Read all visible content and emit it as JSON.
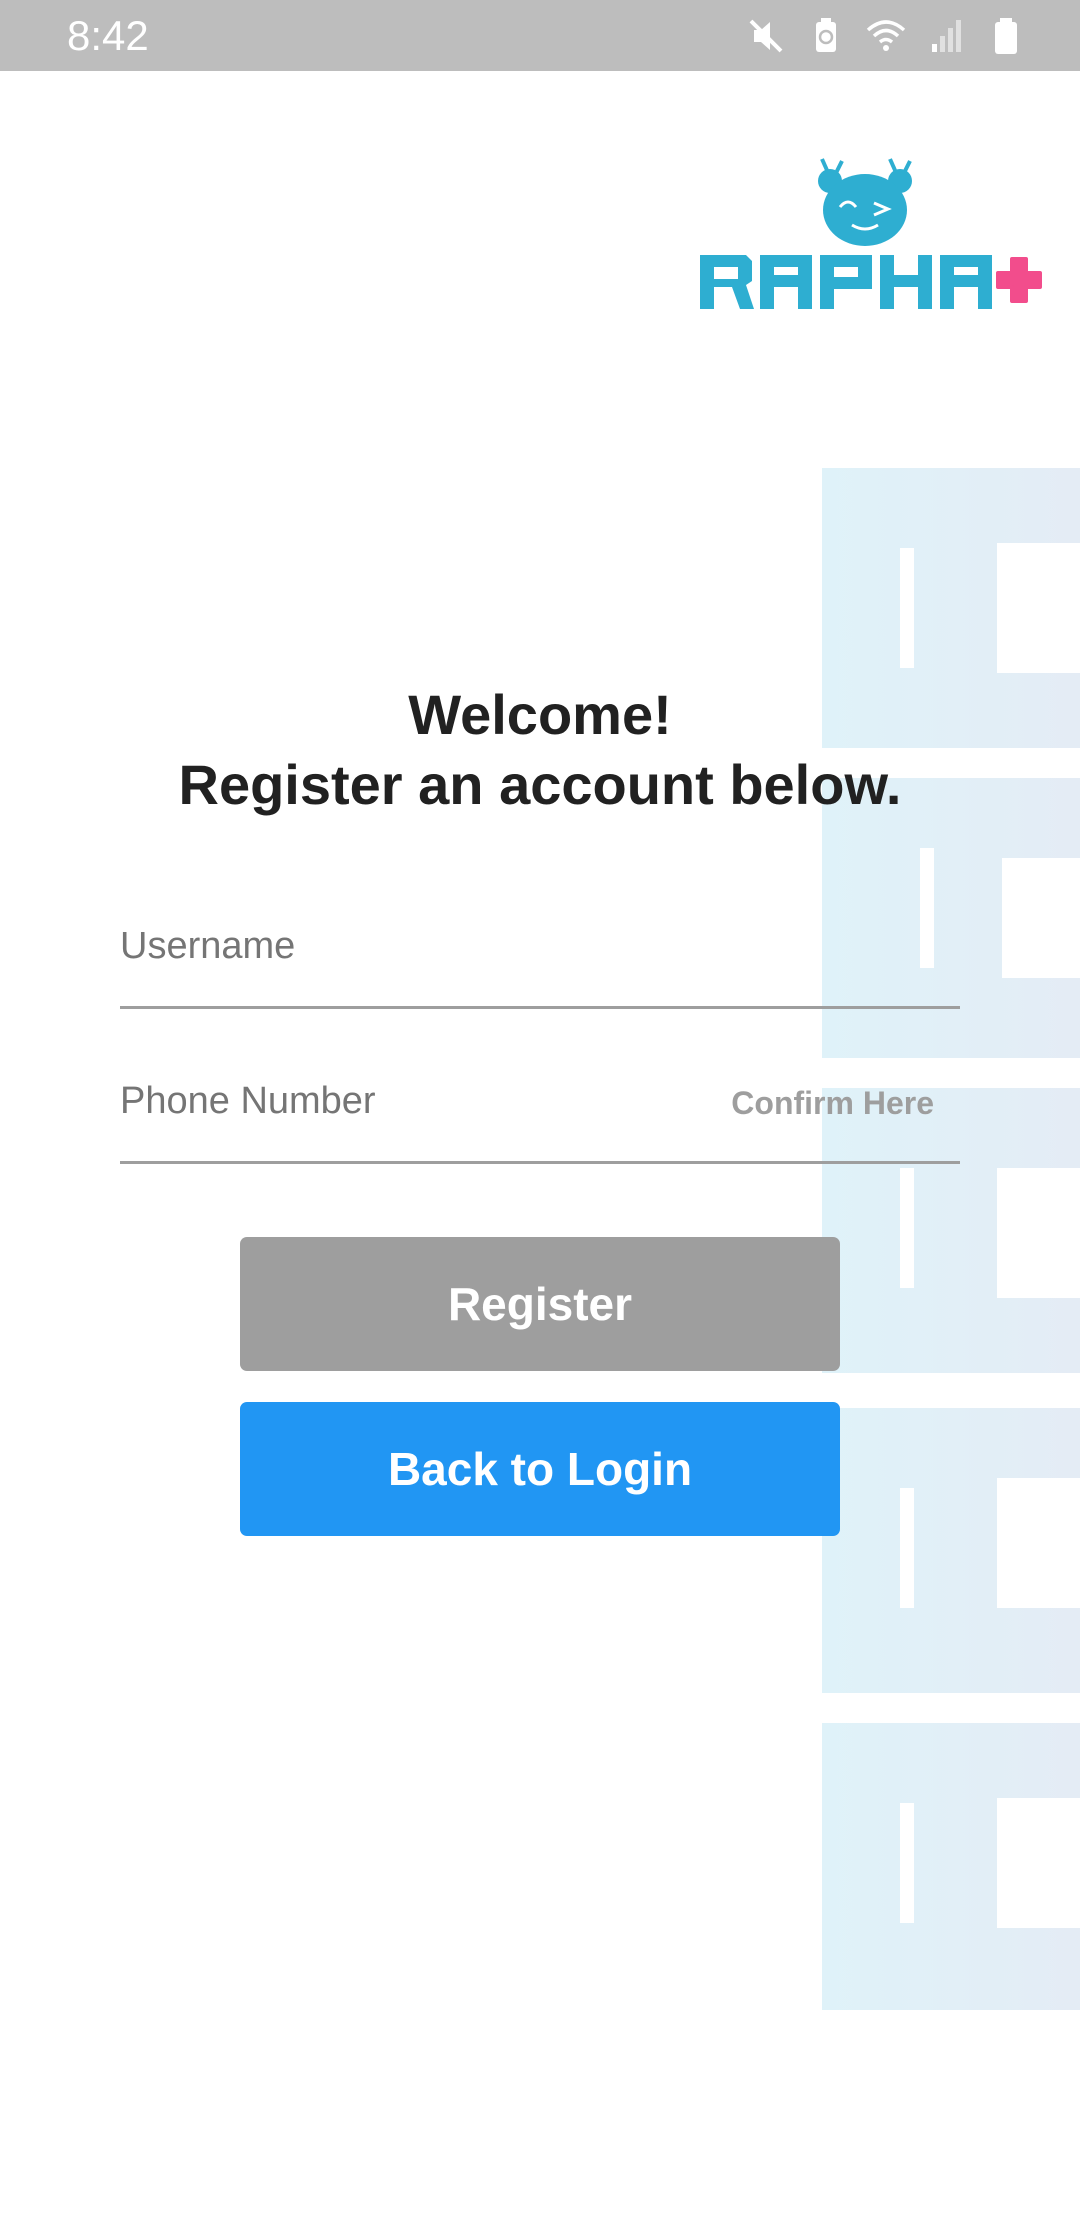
{
  "status_bar": {
    "time": "8:42",
    "icons": [
      "mute-icon",
      "battery-saver-icon",
      "wifi-icon",
      "signal-icon",
      "battery-icon"
    ]
  },
  "logo": {
    "brand": "RAPHA+",
    "colors": {
      "teal": "#2eaed1",
      "pink": "#f24d8c"
    }
  },
  "heading": {
    "line1": "Welcome!",
    "line2": "Register an account below."
  },
  "form": {
    "username_placeholder": "Username",
    "phone_placeholder": "Phone Number",
    "confirm_label": "Confirm Here"
  },
  "buttons": {
    "register_label": "Register",
    "back_label": "Back to Login"
  },
  "colors": {
    "status_bar": "#bdbdbd",
    "register_button": "#9e9e9e",
    "back_button": "#2196f3",
    "watermark": "#dff1f8"
  }
}
